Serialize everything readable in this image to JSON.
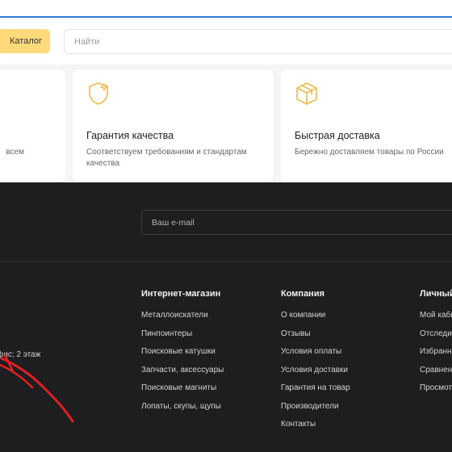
{
  "header": {
    "catalog_label": "Каталог",
    "search_placeholder": "Найти"
  },
  "features": [
    {
      "title": "",
      "description": "всем",
      "icon": ""
    },
    {
      "title": "Гарантия качества",
      "description": "Соответствуем требованиям и стандартам качества",
      "icon": "shield-star-icon"
    },
    {
      "title": "Быстрая доставка",
      "description": "Бережно доставляем товары по России",
      "icon": "box-icon"
    }
  ],
  "footer": {
    "email_placeholder": "Ваш e-mail",
    "address_fragment": "фис; 2 этаж",
    "columns": [
      {
        "title": "Интернет-магазин",
        "links": [
          "Металлоискатели",
          "Пинпоинтеры",
          "Поисковые катушки",
          "Запчасти, аксессуары",
          "Поисковые магниты",
          "Лопаты, скупы, щупы"
        ]
      },
      {
        "title": "Компания",
        "links": [
          "О компании",
          "Отзывы",
          "Условия оплаты",
          "Условия доставки",
          "Гарантия на товар",
          "Производители",
          "Контакты"
        ]
      },
      {
        "title": "Личный",
        "links": [
          "Мой каби",
          "Отследи",
          "Избранн",
          "Сравнен",
          "Просмот"
        ]
      }
    ]
  },
  "colors": {
    "accent": "#ffd97a",
    "icon": "#f2b84b",
    "footer_bg": "#1e1e21",
    "annotation": "#e02020",
    "top_line": "#2f7bd8"
  }
}
